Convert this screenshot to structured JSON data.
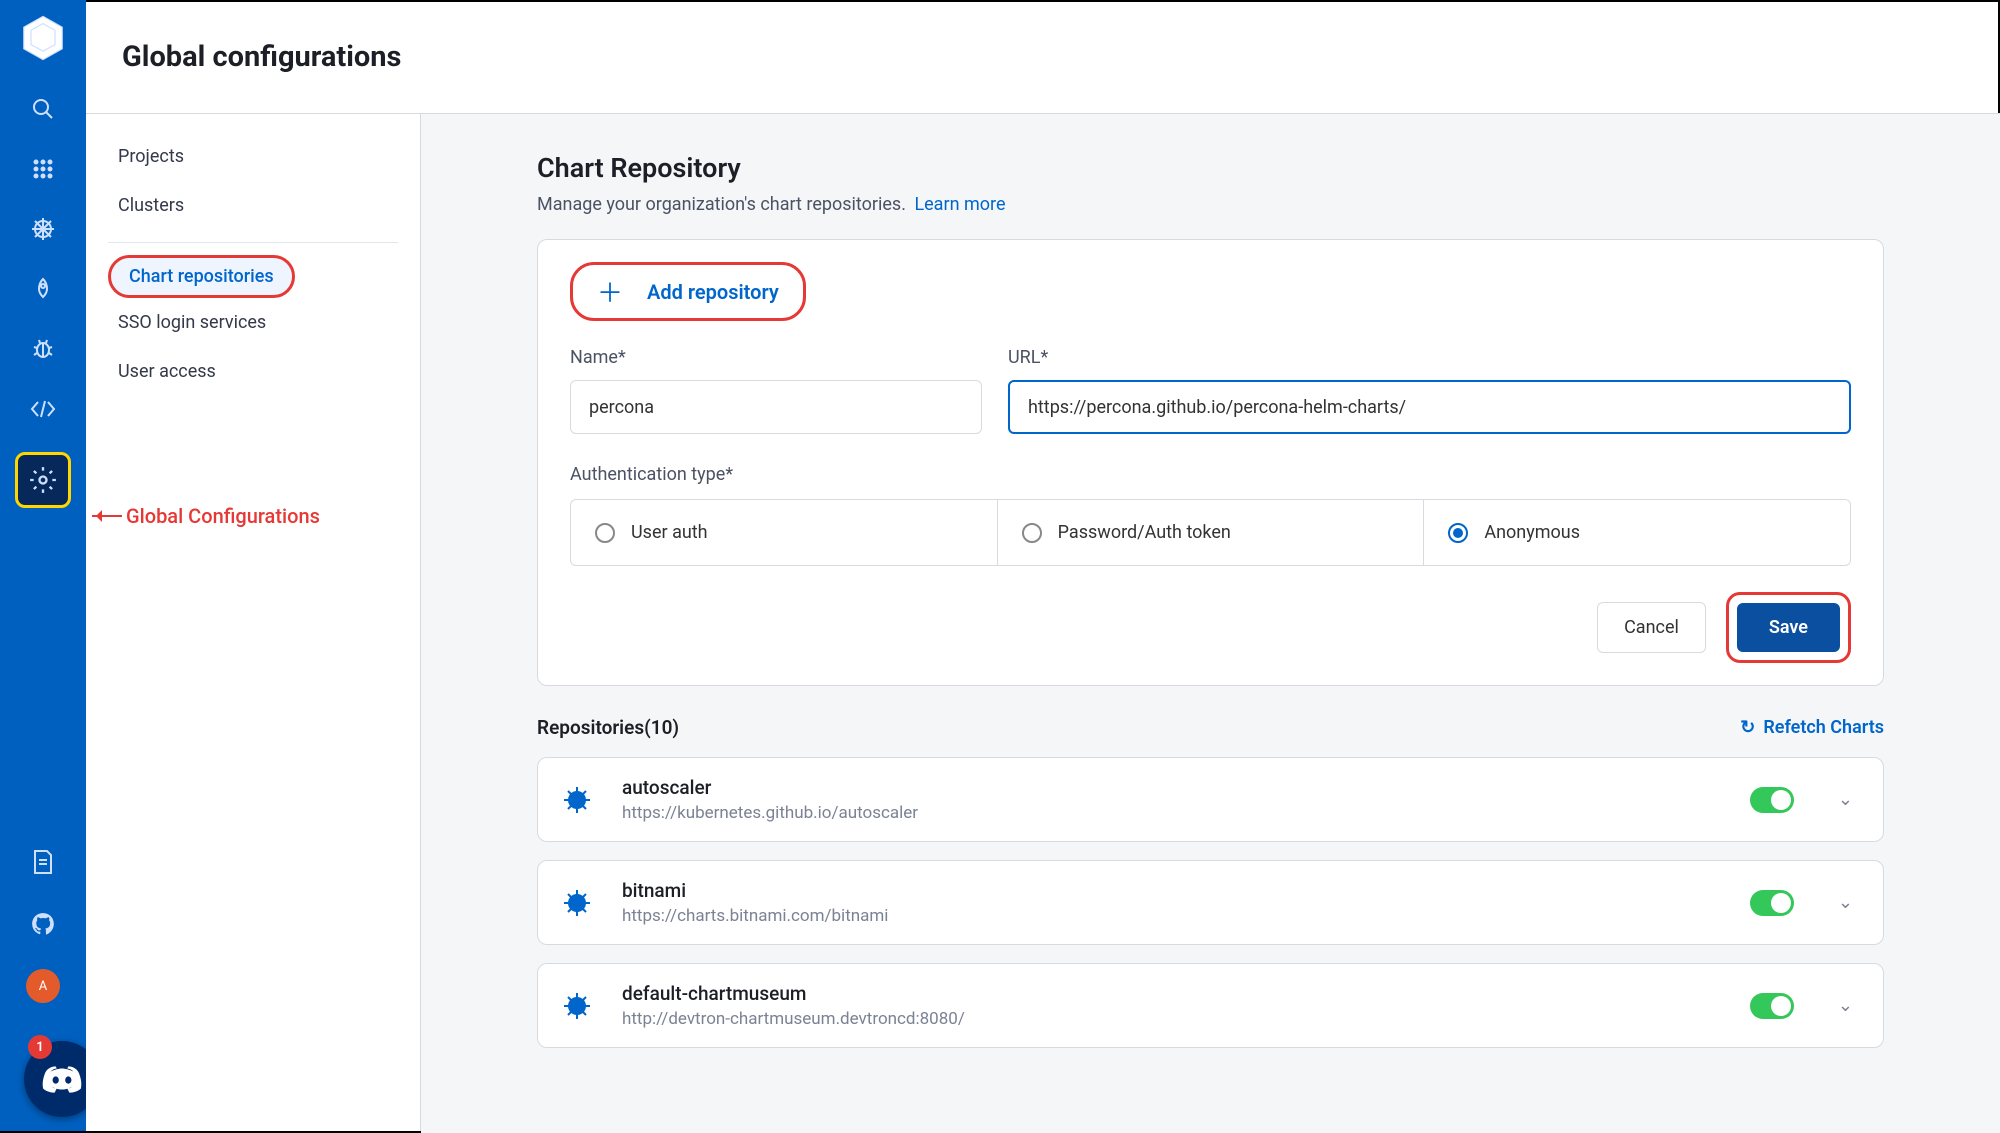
{
  "header": {
    "title": "Global configurations"
  },
  "subnav": {
    "items": [
      "Projects",
      "Clusters",
      "Chart repositories",
      "SSO login services",
      "User access"
    ],
    "active_index": 2
  },
  "annotation": {
    "global_config_label": "Global Configurations"
  },
  "page": {
    "title": "Chart Repository",
    "subtitle": "Manage your organization's chart repositories.",
    "learn_more": "Learn more",
    "add_button": "Add repository"
  },
  "form": {
    "name_label": "Name*",
    "name_value": "percona",
    "url_label": "URL*",
    "url_value": "https://percona.github.io/percona-helm-charts/",
    "auth_label": "Authentication type*",
    "auth_options": [
      "User auth",
      "Password/Auth token",
      "Anonymous"
    ],
    "auth_selected_index": 2,
    "cancel": "Cancel",
    "save": "Save"
  },
  "list": {
    "heading": "Repositories(10)",
    "refetch": "Refetch Charts",
    "repos": [
      {
        "name": "autoscaler",
        "url": "https://kubernetes.github.io/autoscaler"
      },
      {
        "name": "bitnami",
        "url": "https://charts.bitnami.com/bitnami"
      },
      {
        "name": "default-chartmuseum",
        "url": "http://devtron-chartmuseum.devtroncd:8080/"
      }
    ]
  },
  "rail": {
    "avatar_letter": "A",
    "discord_badge": "1"
  }
}
